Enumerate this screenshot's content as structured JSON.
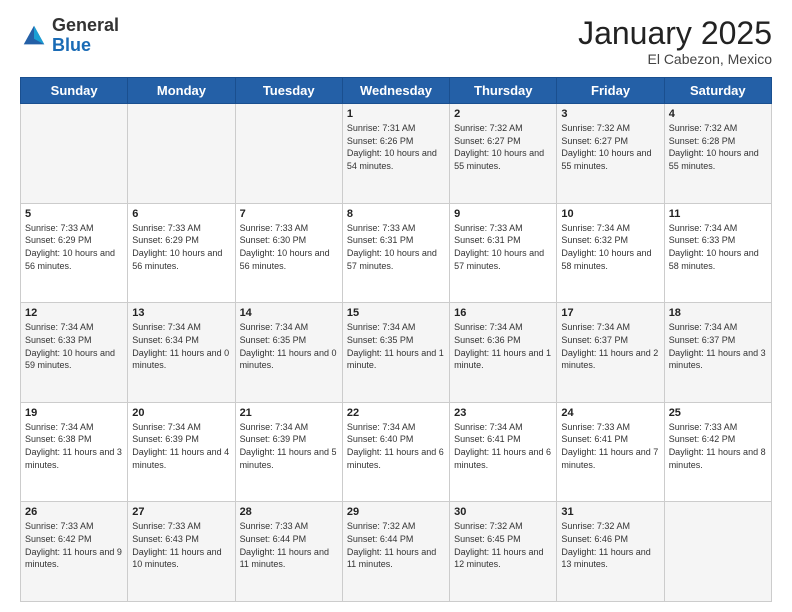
{
  "header": {
    "logo": {
      "general": "General",
      "blue": "Blue"
    },
    "title": "January 2025",
    "location": "El Cabezon, Mexico"
  },
  "days_of_week": [
    "Sunday",
    "Monday",
    "Tuesday",
    "Wednesday",
    "Thursday",
    "Friday",
    "Saturday"
  ],
  "weeks": [
    [
      {
        "day": "",
        "info": ""
      },
      {
        "day": "",
        "info": ""
      },
      {
        "day": "",
        "info": ""
      },
      {
        "day": "1",
        "info": "Sunrise: 7:31 AM\nSunset: 6:26 PM\nDaylight: 10 hours and 54 minutes."
      },
      {
        "day": "2",
        "info": "Sunrise: 7:32 AM\nSunset: 6:27 PM\nDaylight: 10 hours and 55 minutes."
      },
      {
        "day": "3",
        "info": "Sunrise: 7:32 AM\nSunset: 6:27 PM\nDaylight: 10 hours and 55 minutes."
      },
      {
        "day": "4",
        "info": "Sunrise: 7:32 AM\nSunset: 6:28 PM\nDaylight: 10 hours and 55 minutes."
      }
    ],
    [
      {
        "day": "5",
        "info": "Sunrise: 7:33 AM\nSunset: 6:29 PM\nDaylight: 10 hours and 56 minutes."
      },
      {
        "day": "6",
        "info": "Sunrise: 7:33 AM\nSunset: 6:29 PM\nDaylight: 10 hours and 56 minutes."
      },
      {
        "day": "7",
        "info": "Sunrise: 7:33 AM\nSunset: 6:30 PM\nDaylight: 10 hours and 56 minutes."
      },
      {
        "day": "8",
        "info": "Sunrise: 7:33 AM\nSunset: 6:31 PM\nDaylight: 10 hours and 57 minutes."
      },
      {
        "day": "9",
        "info": "Sunrise: 7:33 AM\nSunset: 6:31 PM\nDaylight: 10 hours and 57 minutes."
      },
      {
        "day": "10",
        "info": "Sunrise: 7:34 AM\nSunset: 6:32 PM\nDaylight: 10 hours and 58 minutes."
      },
      {
        "day": "11",
        "info": "Sunrise: 7:34 AM\nSunset: 6:33 PM\nDaylight: 10 hours and 58 minutes."
      }
    ],
    [
      {
        "day": "12",
        "info": "Sunrise: 7:34 AM\nSunset: 6:33 PM\nDaylight: 10 hours and 59 minutes."
      },
      {
        "day": "13",
        "info": "Sunrise: 7:34 AM\nSunset: 6:34 PM\nDaylight: 11 hours and 0 minutes."
      },
      {
        "day": "14",
        "info": "Sunrise: 7:34 AM\nSunset: 6:35 PM\nDaylight: 11 hours and 0 minutes."
      },
      {
        "day": "15",
        "info": "Sunrise: 7:34 AM\nSunset: 6:35 PM\nDaylight: 11 hours and 1 minute."
      },
      {
        "day": "16",
        "info": "Sunrise: 7:34 AM\nSunset: 6:36 PM\nDaylight: 11 hours and 1 minute."
      },
      {
        "day": "17",
        "info": "Sunrise: 7:34 AM\nSunset: 6:37 PM\nDaylight: 11 hours and 2 minutes."
      },
      {
        "day": "18",
        "info": "Sunrise: 7:34 AM\nSunset: 6:37 PM\nDaylight: 11 hours and 3 minutes."
      }
    ],
    [
      {
        "day": "19",
        "info": "Sunrise: 7:34 AM\nSunset: 6:38 PM\nDaylight: 11 hours and 3 minutes."
      },
      {
        "day": "20",
        "info": "Sunrise: 7:34 AM\nSunset: 6:39 PM\nDaylight: 11 hours and 4 minutes."
      },
      {
        "day": "21",
        "info": "Sunrise: 7:34 AM\nSunset: 6:39 PM\nDaylight: 11 hours and 5 minutes."
      },
      {
        "day": "22",
        "info": "Sunrise: 7:34 AM\nSunset: 6:40 PM\nDaylight: 11 hours and 6 minutes."
      },
      {
        "day": "23",
        "info": "Sunrise: 7:34 AM\nSunset: 6:41 PM\nDaylight: 11 hours and 6 minutes."
      },
      {
        "day": "24",
        "info": "Sunrise: 7:33 AM\nSunset: 6:41 PM\nDaylight: 11 hours and 7 minutes."
      },
      {
        "day": "25",
        "info": "Sunrise: 7:33 AM\nSunset: 6:42 PM\nDaylight: 11 hours and 8 minutes."
      }
    ],
    [
      {
        "day": "26",
        "info": "Sunrise: 7:33 AM\nSunset: 6:42 PM\nDaylight: 11 hours and 9 minutes."
      },
      {
        "day": "27",
        "info": "Sunrise: 7:33 AM\nSunset: 6:43 PM\nDaylight: 11 hours and 10 minutes."
      },
      {
        "day": "28",
        "info": "Sunrise: 7:33 AM\nSunset: 6:44 PM\nDaylight: 11 hours and 11 minutes."
      },
      {
        "day": "29",
        "info": "Sunrise: 7:32 AM\nSunset: 6:44 PM\nDaylight: 11 hours and 11 minutes."
      },
      {
        "day": "30",
        "info": "Sunrise: 7:32 AM\nSunset: 6:45 PM\nDaylight: 11 hours and 12 minutes."
      },
      {
        "day": "31",
        "info": "Sunrise: 7:32 AM\nSunset: 6:46 PM\nDaylight: 11 hours and 13 minutes."
      },
      {
        "day": "",
        "info": ""
      }
    ]
  ]
}
